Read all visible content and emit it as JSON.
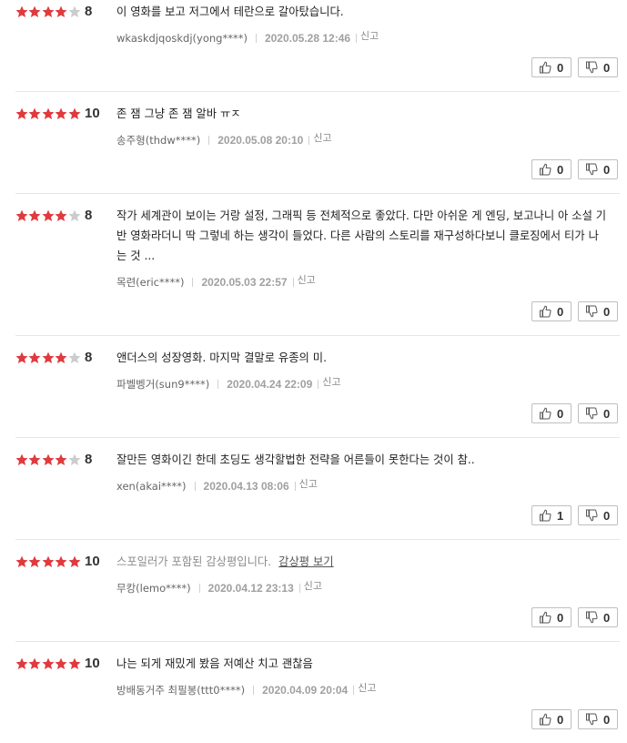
{
  "colors": {
    "star_on": "#e03a3e",
    "star_off": "#cccccc"
  },
  "icons": {
    "like": "thumbs-up-icon",
    "dislike": "thumbs-down-icon",
    "star": "star-icon"
  },
  "reviews": [
    {
      "stars_filled": 4,
      "score": "8",
      "text": "이 영화를 보고 저그에서 테란으로 갈아탔습니다.",
      "spoiler": false,
      "spoiler_link": "",
      "user": "wkaskdjqoskdj(yong****)",
      "date": "2020.05.28 12:46",
      "report": "신고",
      "likes": "0",
      "dislikes": "0"
    },
    {
      "stars_filled": 5,
      "score": "10",
      "text": "존 잼 그냥 존 잼 알바 ㅠㅈ",
      "spoiler": false,
      "spoiler_link": "",
      "user": "송주형(thdw****)",
      "date": "2020.05.08 20:10",
      "report": "신고",
      "likes": "0",
      "dislikes": "0"
    },
    {
      "stars_filled": 4,
      "score": "8",
      "text": "작가 세계관이 보이는 거랑 설정, 그래픽 등 전체적으로 좋았다. 다만 아쉬운 게 엔딩, 보고나니 아 소설 기반 영화라더니 딱 그렇네 하는 생각이 들었다. 다른 사람의 스토리를 재구성하다보니 클로징에서 티가 나는 것 ...",
      "spoiler": false,
      "spoiler_link": "",
      "user": "목련(eric****)",
      "date": "2020.05.03 22:57",
      "report": "신고",
      "likes": "0",
      "dislikes": "0"
    },
    {
      "stars_filled": 4,
      "score": "8",
      "text": "앤더스의 성장영화. 마지막 결말로 유종의 미.",
      "spoiler": false,
      "spoiler_link": "",
      "user": "파벨벵거(sun9****)",
      "date": "2020.04.24 22:09",
      "report": "신고",
      "likes": "0",
      "dislikes": "0"
    },
    {
      "stars_filled": 4,
      "score": "8",
      "text": "잘만든 영화이긴 한데 초딩도 생각할법한 전략을 어른들이 못한다는 것이 참..",
      "spoiler": false,
      "spoiler_link": "",
      "user": "xen(akai****)",
      "date": "2020.04.13 08:06",
      "report": "신고",
      "likes": "1",
      "dislikes": "0"
    },
    {
      "stars_filled": 5,
      "score": "10",
      "text": "스포일러가 포함된 감상평입니다.",
      "spoiler": true,
      "spoiler_link": "감상평 보기",
      "user": "무캉(lemo****)",
      "date": "2020.04.12 23:13",
      "report": "신고",
      "likes": "0",
      "dislikes": "0"
    },
    {
      "stars_filled": 5,
      "score": "10",
      "text": "나는 되게 재밌게 봤음 저예산 치고 괜찮음",
      "spoiler": false,
      "spoiler_link": "",
      "user": "방배동거주 최필봉(ttt0****)",
      "date": "2020.04.09 20:04",
      "report": "신고",
      "likes": "0",
      "dislikes": "0"
    }
  ]
}
